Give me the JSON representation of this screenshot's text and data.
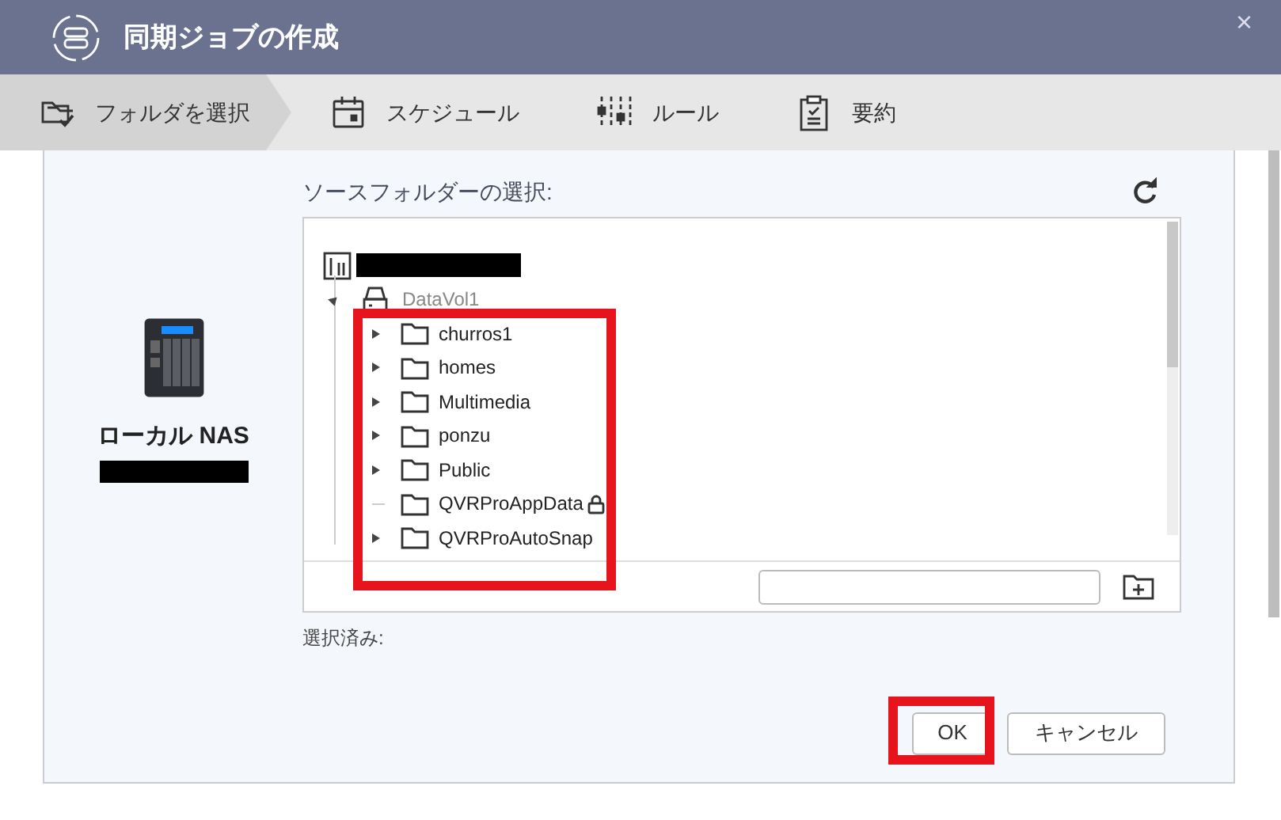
{
  "window": {
    "title": "同期ジョブの作成",
    "close": "×"
  },
  "steps": [
    {
      "label": "フォルダを選択",
      "selected": true,
      "kind": "folder"
    },
    {
      "label": "スケジュール",
      "selected": false,
      "kind": "calendar"
    },
    {
      "label": "ルール",
      "selected": false,
      "kind": "sliders"
    },
    {
      "label": "要約",
      "selected": false,
      "kind": "clipboard"
    }
  ],
  "nas": {
    "label": "ローカル NAS"
  },
  "source_label": "ソースフォルダーの選択:",
  "tree": {
    "expanded": true,
    "children": [
      {
        "label": "DataVol1",
        "expanded": true,
        "children": [
          {
            "label": "churros1",
            "has_children": true,
            "locked": false
          },
          {
            "label": "homes",
            "has_children": true,
            "locked": false
          },
          {
            "label": "Multimedia",
            "has_children": true,
            "locked": false
          },
          {
            "label": "ponzu",
            "has_children": true,
            "locked": false
          },
          {
            "label": "Public",
            "has_children": true,
            "locked": false
          },
          {
            "label": "QVRProAppData",
            "has_children": false,
            "locked": true
          },
          {
            "label": "QVRProAutoSnap",
            "has_children": true,
            "locked": false
          }
        ]
      }
    ]
  },
  "selected_label": "選択済み:",
  "buttons": [
    {
      "label": "OK",
      "kind": "primary"
    },
    {
      "label": "キャンセル",
      "kind": "secondary"
    }
  ]
}
